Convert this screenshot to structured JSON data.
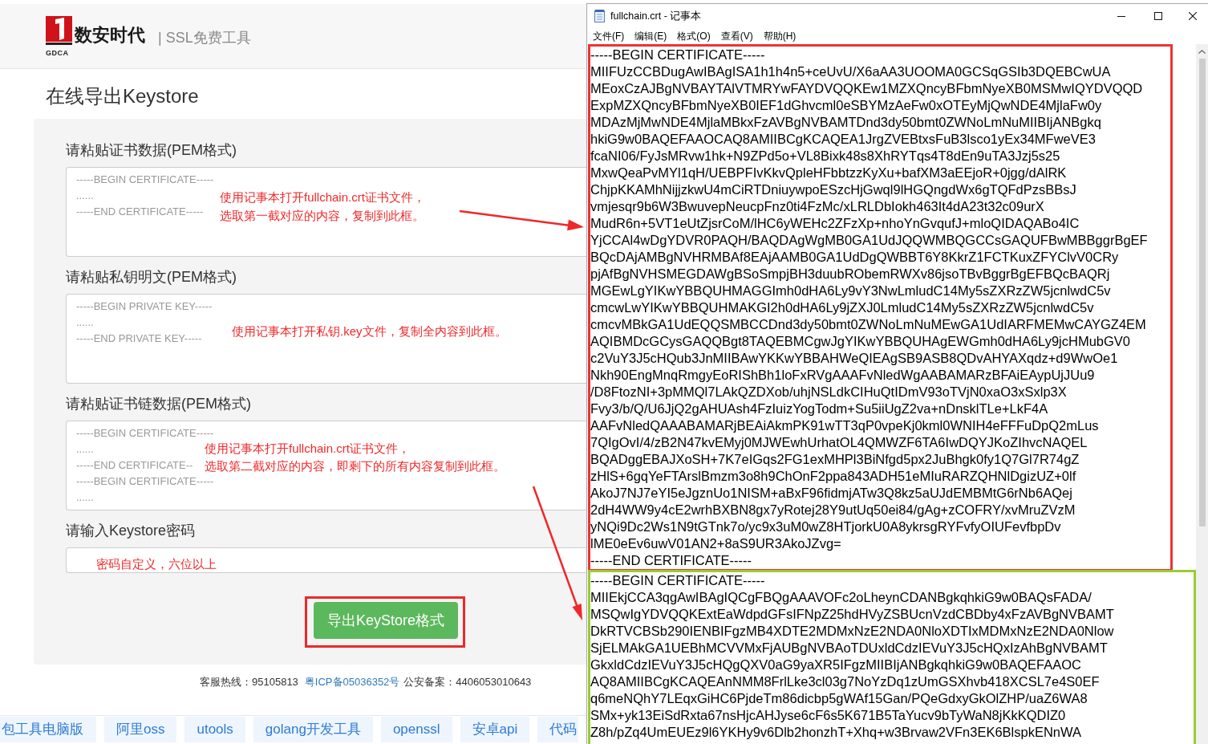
{
  "site_header": {
    "logo_text": "数安时代",
    "logo_caption": "GDCA",
    "tagline": "| SSL免费工具"
  },
  "page_title": "在线导出Keystore",
  "form": {
    "fields": [
      {
        "kind": "textarea",
        "label": "请粘贴证书数据(PEM格式)",
        "placeholder": [
          "-----BEGIN CERTIFICATE-----",
          "......",
          "-----END CERTIFICATE-----"
        ],
        "annotation": [
          "使用记事本打开fullchain.crt证书文件，",
          "选取第一截对应的内容，复制到此框。"
        ]
      },
      {
        "kind": "textarea",
        "label": "请粘贴私钥明文(PEM格式)",
        "placeholder": [
          "-----BEGIN PRIVATE KEY-----",
          "......",
          "-----END PRIVATE KEY-----"
        ],
        "annotation": [
          "使用记事本打开私钥.key文件，复制全内容到此框。"
        ]
      },
      {
        "kind": "textarea",
        "label": "请粘贴证书链数据(PEM格式)",
        "placeholder": [
          "-----BEGIN CERTIFICATE-----",
          "......",
          "-----END CERTIFICATE--",
          "-----BEGIN CERTIFICATE-----",
          "......"
        ],
        "annotation": [
          "使用记事本打开fullchain.crt证书文件，",
          "选取第二截对应的内容，即剩下的所有内容复制到此框。"
        ]
      },
      {
        "kind": "password",
        "label": "请输入Keystore密码",
        "annotation": [
          "密码自定义，六位以上"
        ]
      }
    ],
    "submit_button": "导出KeyStore格式"
  },
  "footer": {
    "hotline": "客服热线：95105813",
    "icp_link": "粤ICP备05036352号",
    "police_record": "公安备案：4406053010643"
  },
  "link_tags": [
    "包工具电脑版",
    "阿里oss",
    "utools",
    "golang开发工具",
    "openssl",
    "安卓api",
    "代码"
  ],
  "notepad": {
    "title": "fullchain.crt - 记事本",
    "menu": [
      "文件(F)",
      "编辑(E)",
      "格式(O)",
      "查看(V)",
      "帮助(H)"
    ],
    "blocks": [
      {
        "color": "#ee3333",
        "lines": [
          "-----BEGIN CERTIFICATE-----",
          "MIIFUzCCBDugAwIBAgISA1h1h4n5+ceUvU/X6aAA3UOOMA0GCSqGSIb3DQEBCwUA",
          "MEoxCzAJBgNVBAYTAlVTMRYwFAYDVQQKEw1MZXQncyBFbmNyeXB0MSMwIQYDVQQD",
          "ExpMZXQncyBFbmNyeXB0IEF1dGhvcml0eSBYMzAeFw0xOTEyMjQwNDE4MjlaFw0y",
          "MDAzMjMwNDE4MjlaMBkxFzAVBgNVBAMTDnd3dy50bmt0ZWNoLmNuMIIBIjANBgkq",
          "hkiG9w0BAQEFAAOCAQ8AMIIBCgKCAQEA1JrgZVEBtxsFuB3lsco1yEx34MFweVE3",
          "fcaNI06/FyJsMRvw1hk+N9ZPd5o+VL8Bixk48s8XhRYTqs4T8dEn9uTA3Jzj5s25",
          "MxwQeaPvMYl1qH/UEBPFIvKkvQpleHFbbtzzKyXu+bafXM3aEEjoR+0jgg/dAlRK",
          "ChjpKKAMhNijjzkwU4mCiRTDniuywpoESzcHjGwql9lHGQngdWx6gTQFdPzsBBsJ",
          "vmjesqr9b6W3BwuvepNeucpFnz0ti4FzMc/xLRLDbIokh463It4dA23t32c09urX",
          "MudR6n+5VT1eUtZjsrCoM/lHC6yWEHc2ZFzXp+nhoYnGvqufJ+mloQIDAQABo4IC",
          "YjCCAl4wDgYDVR0PAQH/BAQDAgWgMB0GA1UdJQQWMBQGCCsGAQUFBwMBBggrBgEF",
          "BQcDAjAMBgNVHRMBAf8EAjAAMB0GA1UdDgQWBBT6Y8KkrZ1FCTKuxZFYClvV0CRy",
          "pjAfBgNVHSMEGDAWgBSoSmpjBH3duubRObemRWXv86jsoTBvBggrBgEFBQcBAQRj",
          "MGEwLgYIKwYBBQUHMAGGImh0dHA6Ly9vY3NwLmludC14My5sZXRzZW5jcnlwdC5v",
          "cmcwLwYIKwYBBQUHMAKGI2h0dHA6Ly9jZXJ0LmludC14My5sZXRzZW5jcnlwdC5v",
          "cmcvMBkGA1UdEQQSMBCCDnd3dy50bmt0ZWNoLmNuMEwGA1UdIARFMEMwCAYGZ4EM",
          "AQIBMDcGCysGAQQBgt8TAQEBMCgwJgYIKwYBBQUHAgEWGmh0dHA6Ly9jcHMubGV0",
          "c2VuY3J5cHQub3JnMIIBAwYKKwYBBAHWeQIEAgSB9ASB8QDvAHYAXqdz+d9WwOe1",
          "Nkh90EngMnqRmgyEoRIShBh1loFxRVgAAAFvNledWgAABAMARzBFAiEAypUjJUu9",
          "/D8FtozNI+3pMMQl7LAkQZDXob/uhjNSLdkCIHuQtIDmV93oTVjN0xaO3xSxlp3X",
          "Fvy3/b/Q/U6JjQ2gAHUAsh4FzIuizYogTodm+Su5iiUgZ2va+nDnsklTLe+LkF4A",
          "AAFvNledQAAABAMARjBEAiAkmPK91wTT3qP0vpeKj0kml0WNIH4eFFFuDpQ2mLus",
          "7QIgOvI/4/zB2N47kvEMyj0MJWEwhUrhatOL4QMWZF6TA6IwDQYJKoZIhvcNAQEL",
          "BQADggEBAJXoSH+7K7eIGqs2FG1exMHPl3BiNfgd5px2JuBhgk0fy1Q7Gl7R74gZ",
          "zHlS+6gqYeFTArslBmzm3o8h9ChOnF2ppa843ADH51eMIuRARZQHNlDgizUZ+0lf",
          "AkoJ7NJ7eYI5eJgznUo1NISM+aBxF96fidmjATw3Q8kz5aUJdEMBMtG6rNb6AQej",
          "2dH4WW9y4cE2wrhBXBN8gx7yRotej28Y9utUq50ei84/gAg+zCOFRY/xvMruZVzM",
          "yNQi9Dc2Ws1N9tGTnk7o/yc9x3uM0wZ8HTjorkU0A8ykrsgRYFvfyOIUFevfbpDv",
          "lME0eEv6uwV01AN2+8aS9UR3AkoJZvg=",
          "-----END CERTIFICATE-----"
        ]
      },
      {
        "color": "#99cc33",
        "lines": [
          "-----BEGIN CERTIFICATE-----",
          "MIIEkjCCA3qgAwIBAgIQCgFBQgAAAVOFc2oLheynCDANBgkqhkiG9w0BAQsFADA/",
          "MSQwIgYDVQQKExtEaWdpdGFsIFNpZ25hdHVyZSBUcnVzdCBDby4xFzAVBgNVBAMT",
          "DkRTVCBSb290IENBIFgzMB4XDTE2MDMxNzE2NDA0NloXDTIxMDMxNzE2NDA0Nlow",
          "SjELMAkGA1UEBhMCVVMxFjAUBgNVBAoTDUxldCdzIEVuY3J5cHQxIzAhBgNVBAMT",
          "GkxldCdzIEVuY3J5cHQgQXV0aG9yaXR5IFgzMIIBIjANBgkqhkiG9w0BAQEFAAOC",
          "AQ8AMIIBCgKCAQEAnNMM8FrlLke3cl03g7NoYzDq1zUmGSXhvb418XCSL7e4S0EF",
          "q6meNQhY7LEqxGiHC6PjdeTm86dicbp5gWAf15Gan/PQeGdxyGkOlZHP/uaZ6WA8",
          "SMx+yk13EiSdRxta67nsHjcAHJyse6cF6s5K671B5TaYucv9bTyWaN8jKkKQDIZ0",
          "Z8h/pZq4UmEUEz9l6YKHy9v6Dlb2honzhT+Xhq+w3Brvaw2VFn3EK6BlspkENnWA"
        ]
      }
    ]
  }
}
